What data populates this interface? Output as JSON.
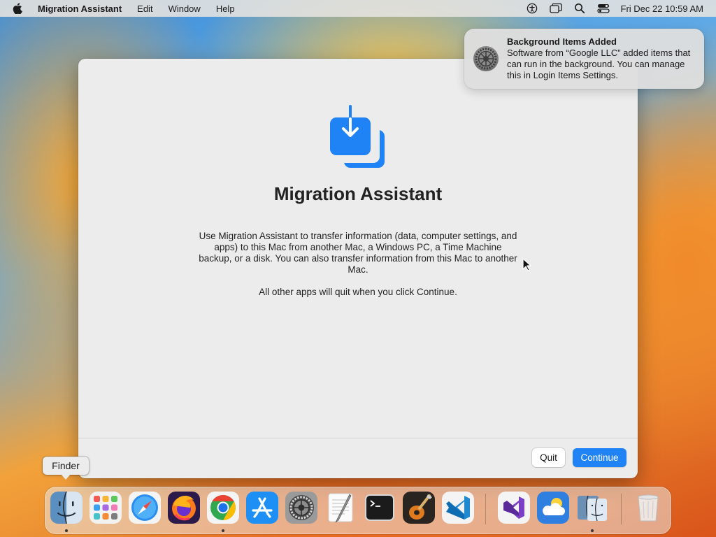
{
  "menubar": {
    "app_name": "Migration Assistant",
    "menus": [
      "Edit",
      "Window",
      "Help"
    ],
    "clock": "Fri Dec 22  10:59 AM",
    "status_icons": [
      "accessibility-icon",
      "screen-mirroring-icon",
      "spotlight-search-icon",
      "control-center-icon"
    ]
  },
  "window": {
    "title": "Migration Assistant",
    "description": "Use Migration Assistant to transfer information (data, computer settings, and apps) to this Mac from another Mac, a Windows PC, a Time Machine backup, or a disk. You can also transfer information from this Mac to another Mac.",
    "quit_note": "All other apps will quit when you click Continue.",
    "quit_label": "Quit",
    "continue_label": "Continue",
    "accent_color": "#1f83f5"
  },
  "notification": {
    "title": "Background Items Added",
    "body": "Software from “Google LLC” added items that can run in the background. You can manage this in Login Items Settings.",
    "icon": "system-settings-gear-icon"
  },
  "tooltip": {
    "label": "Finder"
  },
  "dock": {
    "items": [
      {
        "name": "finder",
        "running": true
      },
      {
        "name": "launchpad",
        "running": false
      },
      {
        "name": "safari",
        "running": false
      },
      {
        "name": "firefox",
        "running": false
      },
      {
        "name": "chrome",
        "running": true
      },
      {
        "name": "app-store",
        "running": false
      },
      {
        "name": "system-settings",
        "running": false
      },
      {
        "name": "textedit",
        "running": false
      },
      {
        "name": "terminal",
        "running": false
      },
      {
        "name": "garageband",
        "running": false
      },
      {
        "name": "vscode",
        "running": false
      },
      {
        "name": "visual-studio",
        "running": false
      },
      {
        "name": "weather",
        "running": false
      },
      {
        "name": "migration-assistant",
        "running": true
      },
      {
        "name": "trash",
        "running": false
      }
    ]
  }
}
